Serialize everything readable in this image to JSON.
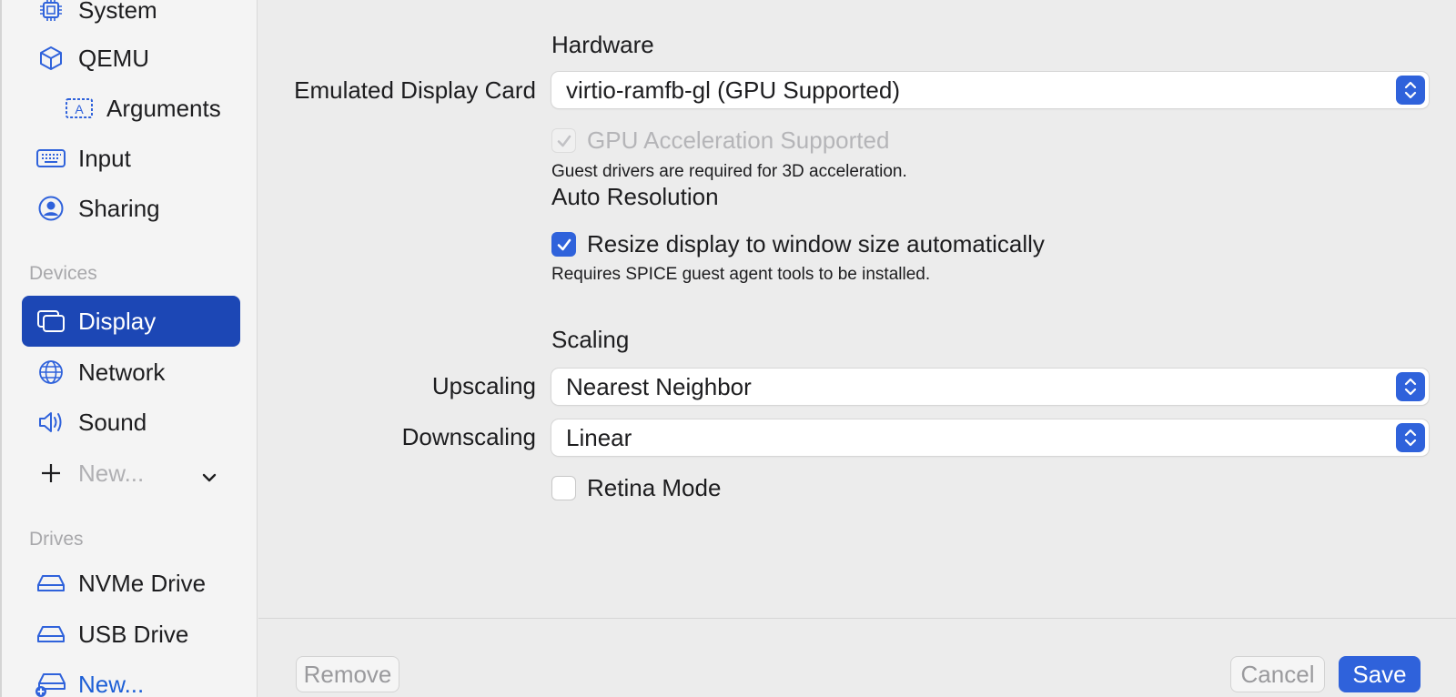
{
  "sidebar": {
    "items": [
      {
        "label": "System",
        "icon": "cpu-icon"
      },
      {
        "label": "QEMU",
        "icon": "cube-icon"
      },
      {
        "label": "Arguments",
        "icon": "textbox-icon"
      },
      {
        "label": "Input",
        "icon": "keyboard-icon"
      },
      {
        "label": "Sharing",
        "icon": "person-circle-icon"
      }
    ],
    "devices_header": "Devices",
    "devices": [
      {
        "label": "Display",
        "icon": "display-icon",
        "selected": true
      },
      {
        "label": "Network",
        "icon": "globe-icon"
      },
      {
        "label": "Sound",
        "icon": "speaker-icon"
      }
    ],
    "new_device_label": "New...",
    "drives_header": "Drives",
    "drives": [
      {
        "label": "NVMe Drive",
        "icon": "drive-icon"
      },
      {
        "label": "USB Drive",
        "icon": "drive-icon"
      }
    ],
    "new_drive_label": "New..."
  },
  "main": {
    "hardware_header": "Hardware",
    "display_card_label": "Emulated Display Card",
    "display_card_value": "virtio-ramfb-gl (GPU Supported)",
    "gpu_accel_label": "GPU Acceleration Supported",
    "gpu_accel_checked": true,
    "gpu_accel_enabled": false,
    "gpu_note": "Guest drivers are required for 3D acceleration.",
    "auto_res_header": "Auto Resolution",
    "resize_label": "Resize display to window size automatically",
    "resize_checked": true,
    "resize_note": "Requires SPICE guest agent tools to be installed.",
    "scaling_header": "Scaling",
    "upscaling_label": "Upscaling",
    "upscaling_value": "Nearest Neighbor",
    "downscaling_label": "Downscaling",
    "downscaling_value": "Linear",
    "retina_label": "Retina Mode",
    "retina_checked": false
  },
  "footer": {
    "remove_label": "Remove",
    "cancel_label": "Cancel",
    "save_label": "Save"
  },
  "colors": {
    "accent": "#2f62db",
    "selection": "#1c47b5"
  }
}
